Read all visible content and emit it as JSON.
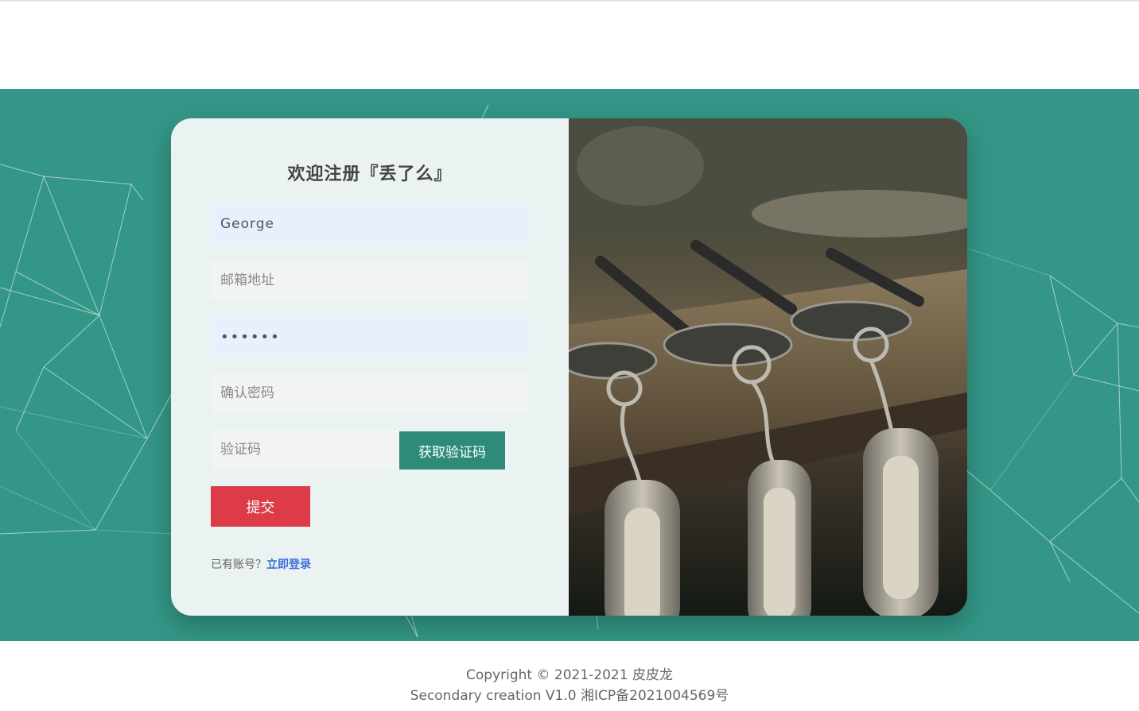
{
  "register": {
    "title": "欢迎注册『丢了么』",
    "username_value": "George",
    "email_placeholder": "邮箱地址",
    "password_value": "••••••",
    "confirm_placeholder": "确认密码",
    "code_placeholder": "验证码",
    "get_code_label": "获取验证码",
    "submit_label": "提交",
    "has_account_text": "已有账号？",
    "login_link_label": "立即登录"
  },
  "footer": {
    "copyright": "Copyright © 2021-2021 皮皮龙",
    "secondary": "Secondary creation V1.0 湘ICP备2021004569号"
  },
  "colors": {
    "hero_bg": "#339686",
    "accent_button": "#2e8b7a",
    "submit_button": "#dc3b47",
    "link": "#3b6fd8"
  }
}
